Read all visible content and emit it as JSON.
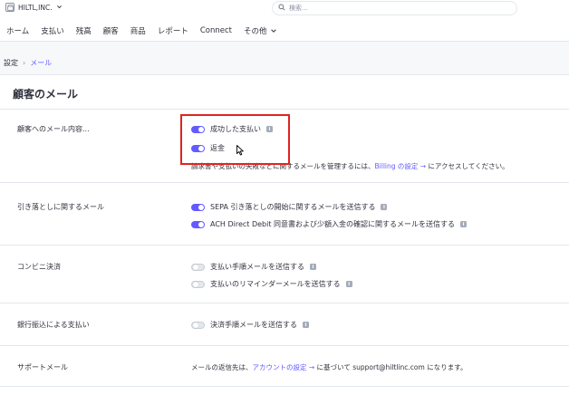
{
  "header": {
    "company": "HILTL,INC.",
    "search_placeholder": "検索..."
  },
  "nav": {
    "items": [
      "ホーム",
      "支払い",
      "残高",
      "顧客",
      "商品",
      "レポート",
      "Connect",
      "その他"
    ]
  },
  "breadcrumb": {
    "parent": "設定",
    "separator": "›",
    "current": "メール"
  },
  "page": {
    "title": "顧客のメール"
  },
  "sections": {
    "customer_emails": {
      "label": "顧客へのメール内容...",
      "toggles": [
        {
          "label": "成功した支払い",
          "on": true
        },
        {
          "label": "返金",
          "on": true
        }
      ],
      "note_prefix": "請求書や支払いの失敗などに関するメールを管理するには、",
      "note_link": "Billing の設定 →",
      "note_suffix": " にアクセスしてください。"
    },
    "direct_debit": {
      "label": "引き落としに関するメール",
      "toggles": [
        {
          "label": "SEPA 引き落としの開始に関するメールを送信する",
          "on": true
        },
        {
          "label": "ACH Direct Debit 同意書および少額入金の確認に関するメールを送信する",
          "on": true
        }
      ]
    },
    "konbini": {
      "label": "コンビニ決済",
      "toggles": [
        {
          "label": "支払い手順メールを送信する",
          "on": false
        },
        {
          "label": "支払いのリマインダーメールを送信する",
          "on": false
        }
      ]
    },
    "bank_transfer": {
      "label": "銀行振込による支払い",
      "toggles": [
        {
          "label": "決済手順メールを送信する",
          "on": false
        }
      ]
    },
    "support": {
      "label": "サポートメール",
      "text_prefix": "メールの返信先は、",
      "link": "アカウントの設定 →",
      "text_suffix": " に基づいて support@hiltlinc.com になります。"
    }
  },
  "colors": {
    "accent": "#635bff",
    "highlight": "#e0241f"
  }
}
